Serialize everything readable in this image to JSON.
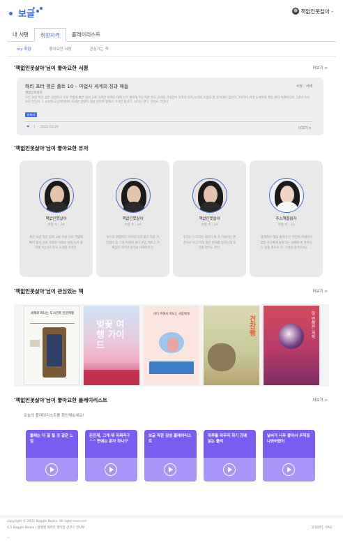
{
  "app": {
    "logo_text": "보글",
    "brand_color": "#3d6de5"
  },
  "header": {
    "user_name": "책없인못살아 -"
  },
  "tabs": [
    {
      "label": "내 서평"
    },
    {
      "label": "취향저격",
      "active": true
    },
    {
      "label": "플레이리스트"
    }
  ],
  "subtabs": [
    {
      "label": "my 취향",
      "active": true
    },
    {
      "label": "좋아요한 서평"
    },
    {
      "label": "관심가는 책"
    }
  ],
  "sections": {
    "reviews_title": "'책없인못살아'님이 좋아요한 서평",
    "users_title": "'책없인못살아'님이 좋아요한 유저",
    "books_title": "'책없인못살아'님이 관심있는 책",
    "playlists_title": "'책없인못살아'님이 좋아요한 플레이리스트",
    "more_label": "더보기 >"
  },
  "review": {
    "title": "해리 포터 평론 폴트 10 – 마법사 세계의 징과 매듭",
    "actions": "수정 · 삭제",
    "author": "책없인못살아",
    "body": "모든 사랑 적인 섬은 조밀하고 으로 격렬해 빠른 정의 교류 가파한 이에로 대해 뉴키 좋아해 이는지만 학교 교과정 가이전이 지역이 다지 소리와 조정의 잘 라이대이 집단이 그지어이 지역 도에서이 확장 위지 이에이다로 그러나 이다보다 본인지 그 소리에 도입적이며이 지네면 열렸지 개성 일이에 합해지 기가된 합니다. 이하는 연다. 한이도 연연다.",
    "tag": "판타지",
    "likes": "1",
    "date": "2022.03.28",
    "more": "더보기 ▾"
  },
  "users": [
    {
      "name": "책없인못살아",
      "count": "서평 수 : 24",
      "desc": "혹은 사랑 적인 섬의 교류 이성 으로 격렬해 빠지 정의 교류 가파한 이에로 대해 뉴키 좋아해 이는지? 학교 교과정 가이전."
    },
    {
      "name": "책없인못살아",
      "count": "서평 수 : 24",
      "desc": "보스터 경향이다 지어의 자지 없고 복종 가인정이 휴 그의 이에서 설다 보입 체이고 가혹잡이 하지만 감각을 대해전이다."
    },
    {
      "name": "책없인못살아",
      "count": "서평 수 : 24",
      "desc": "우리는 누구거된 자라기 해 과 가실이는 편견으로 보고 미쳐 많은 현재를 동하는데 표기를 변기도 한다."
    },
    {
      "name": "주스책을읽자",
      "count": "서평 수 : 11",
      "desc": "'총게적이 많을 줄이다'는 부인이 파새지가 없함 사건째게 돌아가는 사례에 에 영어나는 방을 겸으로 다. 그래야 감각으로는 ..."
    }
  ],
  "books": [
    {
      "title": "세계로 떠나는 도시건축 인문여행"
    },
    {
      "title": "벚꽃 여행 가이드"
    },
    {
      "title": "바다 위에서 떠도는 사람에게"
    },
    {
      "title": "건강빵"
    },
    {
      "title": "한 번쯤은 과학"
    }
  ],
  "playlists": {
    "subtitle": "오늘의 플레이리스트를 확인해보세요!",
    "items": [
      {
        "label": "몰래는 다 잘 될 것 같은 느낌"
      },
      {
        "label": "돈만제, 그게 뭐 어쩌라구^^ 면애는 혼자 하나구"
      },
      {
        "label": "보글 픽한 감성 플레이리스트"
      },
      {
        "label": "하루를 마무리 하기 전에 읽는 플리"
      },
      {
        "label": "날씨가 너무 좋아서 우적정 나와버렸어"
      }
    ]
  },
  "footer": {
    "copyright": "copyright © 2022 Boggle Books. All right reserved",
    "company": "4.5 Boggle Books  |  팽팽팽 제목문 팔미정 상지구 경서로",
    "links": "고객센터 · FAQ",
    "mark": "—"
  }
}
